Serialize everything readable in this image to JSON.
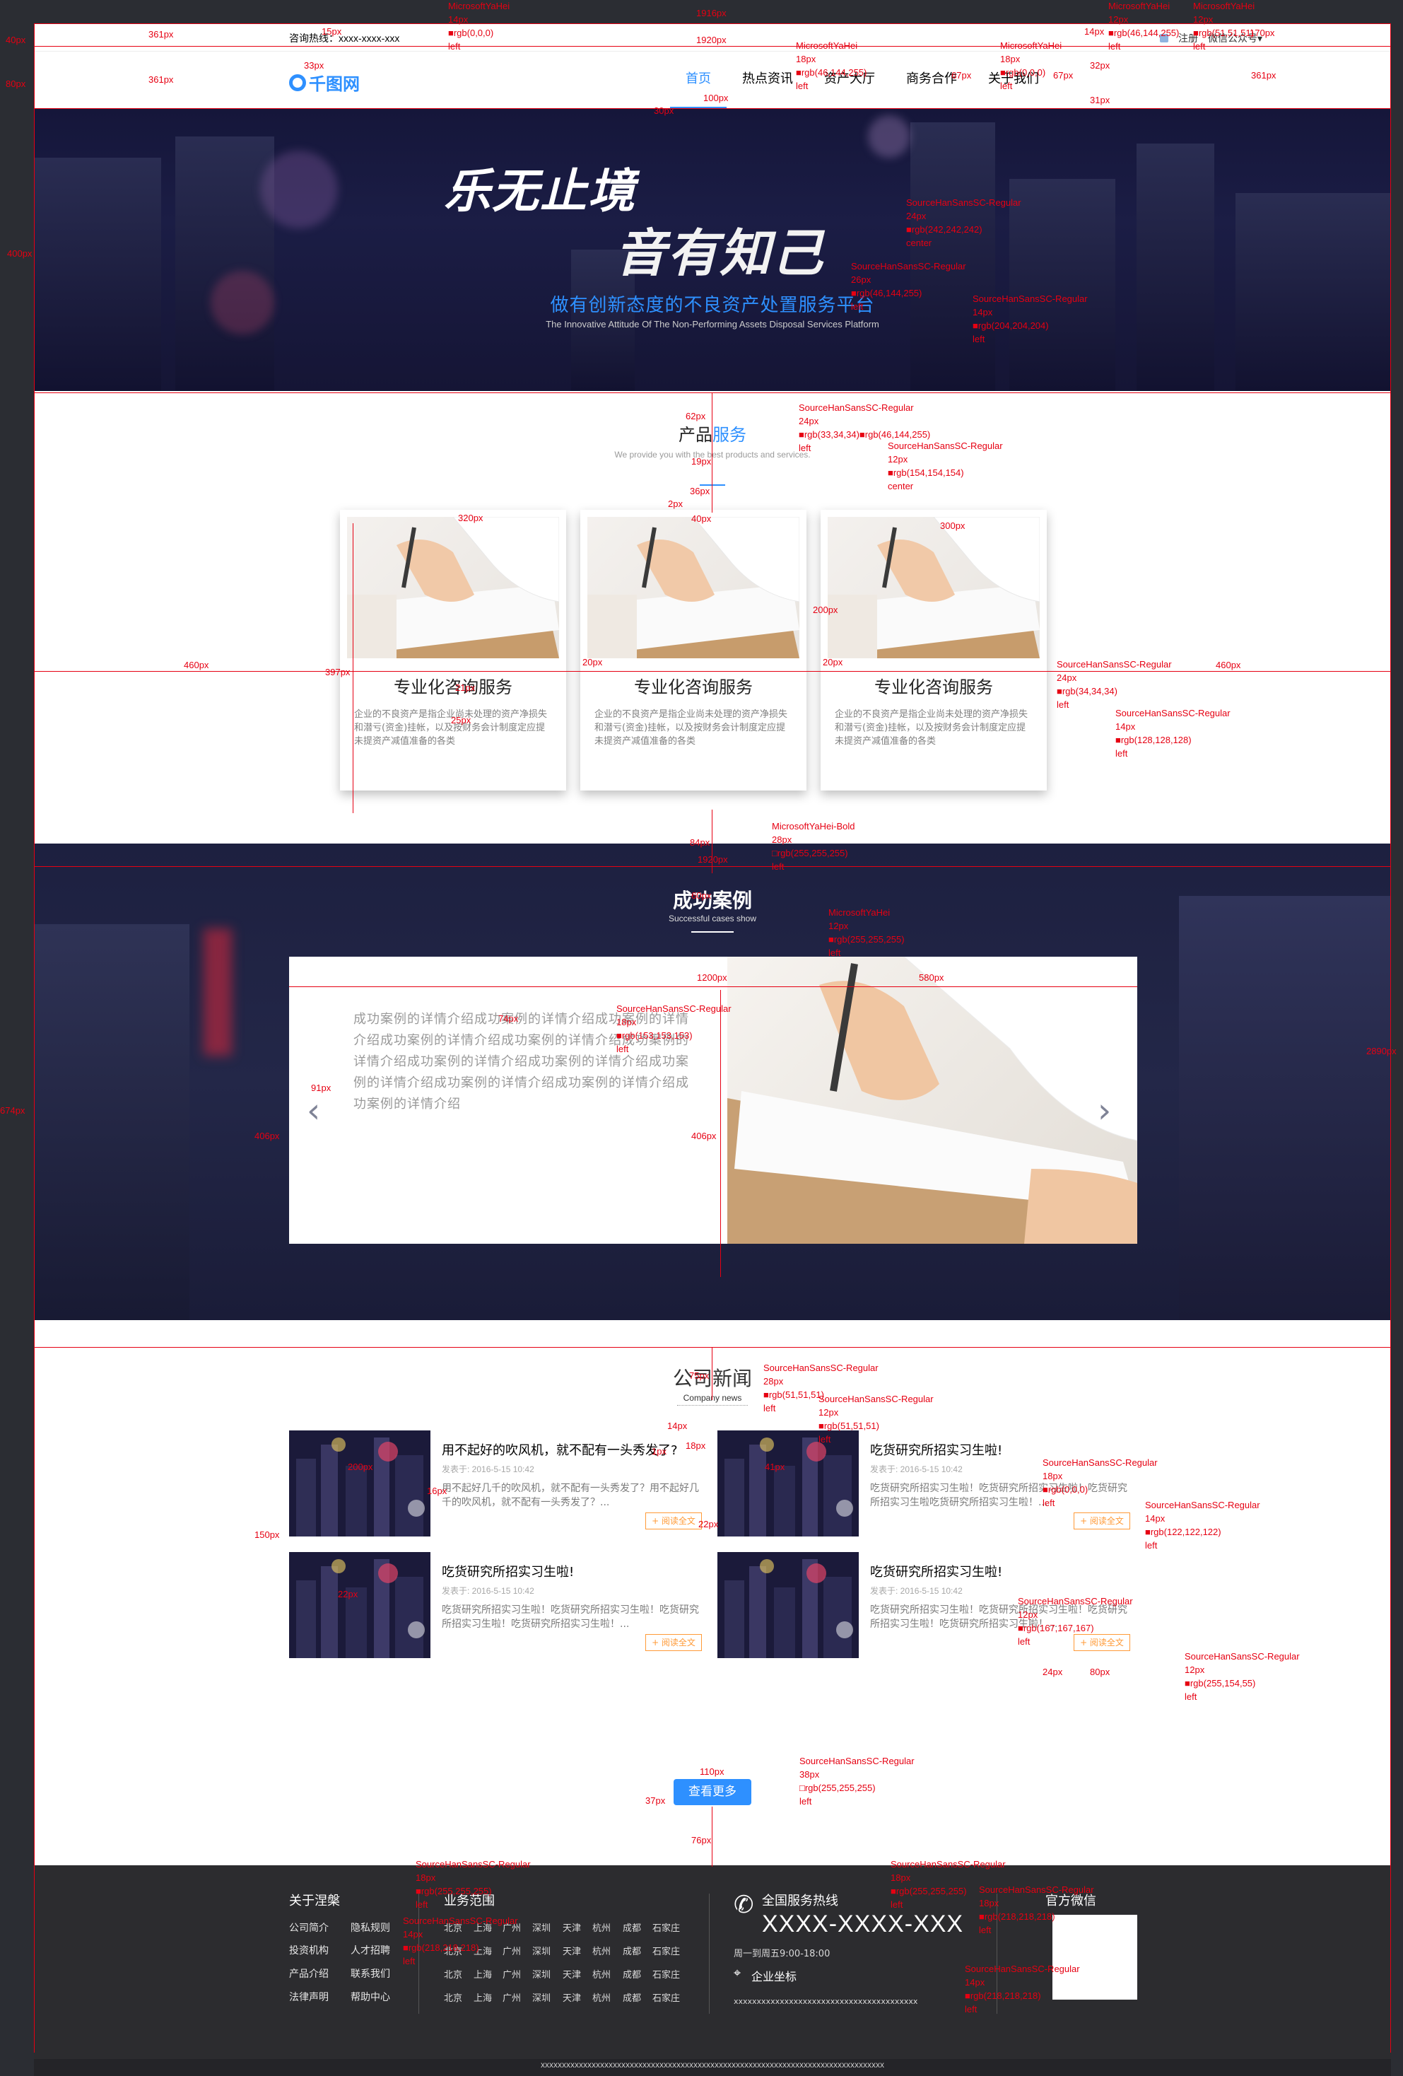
{
  "topbar": {
    "hotline": "咨询热线：xxxx-xxxx-xxx",
    "register": "注册",
    "wechat": "微信公众号▾"
  },
  "nav": {
    "logo_text": "千图网",
    "items": [
      "首页",
      "热点资讯",
      "资产大厅",
      "商务合作",
      "关于我们"
    ]
  },
  "hero": {
    "title1": "乐无止境",
    "title2": "音有知己",
    "subtitle": "做有创新态度的不良资产处置服务平台",
    "subtitle_en": "The Innovative Attitude Of The Non-Performing Assets Disposal Services Platform"
  },
  "products": {
    "title_a": "产品",
    "title_b": "服务",
    "subtitle": "We provide you with the best products and services.",
    "cards": [
      {
        "title": "专业化咨询服务",
        "desc": "企业的不良资产是指企业尚未处理的资产净损失和潜亏(资金)挂帐，以及按财务会计制度定应提未提资产减值准备的各类"
      },
      {
        "title": "专业化咨询服务",
        "desc": "企业的不良资产是指企业尚未处理的资产净损失和潜亏(资金)挂帐，以及按财务会计制度定应提未提资产减值准备的各类"
      },
      {
        "title": "专业化咨询服务",
        "desc": "企业的不良资产是指企业尚未处理的资产净损失和潜亏(资金)挂帐，以及按财务会计制度定应提未提资产减值准备的各类"
      }
    ]
  },
  "cases": {
    "title": "成功案例",
    "subtitle": "Successful cases show",
    "text": "成功案例的详情介绍成功案例的详情介绍成功案例的详情介绍成功案例的详情介绍成功案例的详情介绍成功案例的详情介绍成功案例的详情介绍成功案例的详情介绍成功案例的详情介绍成功案例的详情介绍成功案例的详情介绍成功案例的详情介绍",
    "prev": "‹",
    "next": "›"
  },
  "news": {
    "title": "公司新闻",
    "subtitle": "Company news",
    "items": [
      {
        "title": "用不起好的吹风机，就不配有一头秀发了?",
        "date": "发表于: 2016-5-15  10:42",
        "desc": "用不起好几千的吹风机，就不配有一头秀发了？用不起好几千的吹风机，就不配有一头秀发了？...",
        "more": "+ 阅读全文"
      },
      {
        "title": "吃货研究所招实习生啦!",
        "date": "发表于: 2016-5-15  10:42",
        "desc": "吃货研究所招实习生啦！吃货研究所招实习生啦！吃货研究所招实习生啦吃货研究所招实习生啦！...",
        "more": "+ 阅读全文"
      },
      {
        "title": "吃货研究所招实习生啦!",
        "date": "发表于: 2016-5-15  10:42",
        "desc": "吃货研究所招实习生啦！吃货研究所招实习生啦！吃货研究所招实习生啦！吃货研究所招实习生啦！...",
        "more": "+ 阅读全文"
      },
      {
        "title": "吃货研究所招实习生啦!",
        "date": "发表于: 2016-5-15  10:42",
        "desc": "吃货研究所招实习生啦！吃货研究所招实习生啦！吃货研究所招实习生啦！吃货研究所招实习生啦！...",
        "more": "+ 阅读全文"
      }
    ],
    "view_more": "查看更多"
  },
  "footer": {
    "about_title": "关于涅槃",
    "about_links": [
      "公司简介",
      "隐私规则",
      "投资机构",
      "人才招聘",
      "产品介绍",
      "联系我们",
      "法律声明",
      "帮助中心"
    ],
    "scope_title": "业务范围",
    "cities": [
      "北京",
      "上海",
      "广州",
      "深圳",
      "天津",
      "杭州",
      "成都",
      "石家庄"
    ],
    "hotline_title": "全国服务热线",
    "phone": "XXXX-XXXX-XXX",
    "hours": "周一到周五9:00-18:00",
    "location_title": "企业坐标",
    "address": "xxxxxxxxxxxxxxxxxxxxxxxxxxxxxxxxxxxxxxxx",
    "wechat_title": "官方微信",
    "copyright": "xxxxxxxxxxxxxxxxxxxxxxxxxxxxxxxxxxxxxxxxxxxxxxxxxxxxxxxxxxxxxxxxxxxxxxxxxxxxxxxxx"
  },
  "annotations": {
    "dims": {
      "d1916": "1916px",
      "d40": "40px",
      "d80": "80px",
      "d400": "400px",
      "d674": "674px",
      "d2890": "2890px",
      "d361": "361px",
      "d15": "15px",
      "d33": "33px",
      "d1920": "1920px",
      "d100": "100px",
      "d30": "30px",
      "d67": "67px",
      "d32": "32px",
      "d31": "31px",
      "d14": "14px",
      "d170": "170px",
      "d62": "62px",
      "d19": "19px",
      "d36": "36px",
      "d2": "2px",
      "d320": "320px",
      "d300": "300px",
      "d460": "460px",
      "d397": "397px",
      "d200": "200px",
      "d20": "20px",
      "d21": "21px",
      "d25": "25px",
      "d84": "84px",
      "d60": "60px",
      "d1200": "1200px",
      "d580": "580px",
      "d74": "74px",
      "d91": "91px",
      "d406": "406px",
      "d75": "75px",
      "d1": "1px",
      "d18": "18px",
      "d41": "41px",
      "d150": "150px",
      "d16": "16px",
      "d22": "22px",
      "d24": "24px",
      "d110": "110px",
      "d37": "37px",
      "d76": "76px"
    },
    "specs": {
      "s_top_hot": [
        "MicrosoftYaHei",
        "14px",
        "■rgb(0,0,0)",
        "left"
      ],
      "s_nav": [
        "MicrosoftYaHei",
        "18px",
        "■rgb(46,144,255)",
        "left"
      ],
      "s_nav2": [
        "MicrosoftYaHei",
        "18px",
        "■rgb(0,0,0)",
        "left"
      ],
      "s_top_r1": [
        "MicrosoftYaHei",
        "12px",
        "■rgb(46,144,255)",
        "left"
      ],
      "s_top_r2": [
        "MicrosoftYaHei",
        "12px",
        "■rgb(51,51,51)",
        "left"
      ],
      "s_hero1": [
        "SourceHanSansSC-Regular",
        "24px",
        "■rgb(242,242,242)",
        "center"
      ],
      "s_hero2": [
        "SourceHanSansSC-Regular",
        "26px",
        "■rgb(46,144,255)",
        "left"
      ],
      "s_hero3": [
        "SourceHanSansSC-Regular",
        "14px",
        "■rgb(204,204,204)",
        "left"
      ],
      "s_prod_t": [
        "SourceHanSansSC-Regular",
        "24px",
        "■rgb(33,34,34)■rgb(46,144,255)",
        "left"
      ],
      "s_prod_s": [
        "SourceHanSansSC-Regular",
        "12px",
        "■rgb(154,154,154)",
        "center"
      ],
      "s_card_t": [
        "SourceHanSansSC-Regular",
        "24px",
        "■rgb(34,34,34)",
        "left"
      ],
      "s_card_d": [
        "SourceHanSansSC-Regular",
        "14px",
        "■rgb(128,128,128)",
        "left"
      ],
      "s_case_t": [
        "MicrosoftYaHei-Bold",
        "28px",
        "□rgb(255,255,255)",
        "left"
      ],
      "s_case_s": [
        "MicrosoftYaHei",
        "12px",
        "■rgb(255,255,255)",
        "left"
      ],
      "s_case_txt": [
        "SourceHanSansSC-Regular",
        "18px",
        "■rgb(153,153,153)",
        "left"
      ],
      "s_news_t": [
        "SourceHanSansSC-Regular",
        "28px",
        "■rgb(51,51,51)",
        "left"
      ],
      "s_news_s": [
        "SourceHanSansSC-Regular",
        "12px",
        "■rgb(51,51,51)",
        "left"
      ],
      "s_ni_t": [
        "SourceHanSansSC-Regular",
        "18px",
        "■rgb(0,0,0)",
        "left"
      ],
      "s_ni_d": [
        "SourceHanSansSC-Regular",
        "14px",
        "■rgb(122,122,122)",
        "left"
      ],
      "s_ni_date": [
        "SourceHanSansSC-Regular",
        "12px",
        "■rgb(167,167,167)",
        "left"
      ],
      "s_ni_more": [
        "SourceHanSansSC-Regular",
        "12px",
        "■rgb(255,154,55)",
        "left"
      ],
      "s_btn": [
        "SourceHanSansSC-Regular",
        "38px",
        "□rgb(255,255,255)",
        "left"
      ],
      "s_f1": [
        "SourceHanSansSC-Regular",
        "18px",
        "■rgb(255,255,255)",
        "left"
      ],
      "s_f2": [
        "SourceHanSansSC-Regular",
        "14px",
        "■rgb(218,218,218)",
        "left"
      ],
      "s_f3": [
        "SourceHanSansSC-Regular",
        "18px",
        "■rgb(255,255,255)",
        "left"
      ],
      "s_f4": [
        "SourceHanSansSC-Regular",
        "18px",
        "■rgb(218,218,218)",
        "left"
      ],
      "s_f5": [
        "SourceHanSansSC-Regular",
        "14px",
        "■rgb(218,218,218)",
        "left"
      ]
    }
  },
  "colors": {
    "accent": "#2e90ff",
    "annotation": "#e60012",
    "more": "#ff9a37",
    "footer": "#2c2c2f"
  }
}
